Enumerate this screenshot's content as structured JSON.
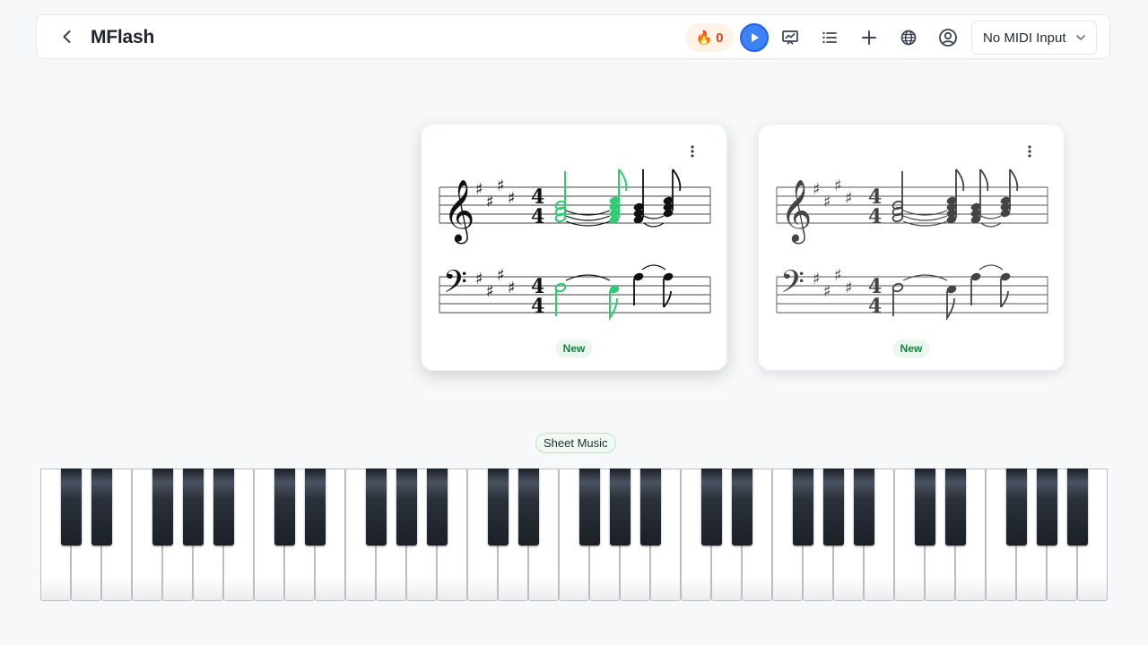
{
  "app": {
    "title": "MFlash"
  },
  "toolbar": {
    "streak_icon": "🔥",
    "streak_count": "0",
    "icons": [
      "back-icon",
      "play-icon",
      "chart-icon",
      "list-icon",
      "plus-icon",
      "globe-icon",
      "user-icon",
      "chevron-down-icon"
    ],
    "midi_input": "No MIDI Input"
  },
  "cards": [
    {
      "badge": "New",
      "highlight_color": "#2ecc71"
    },
    {
      "badge": "New"
    }
  ],
  "sheet_music_label": "Sheet Music",
  "colors": {
    "accent": "#3b82f6",
    "success": "#2ecc71",
    "streak": "#e0451f"
  }
}
